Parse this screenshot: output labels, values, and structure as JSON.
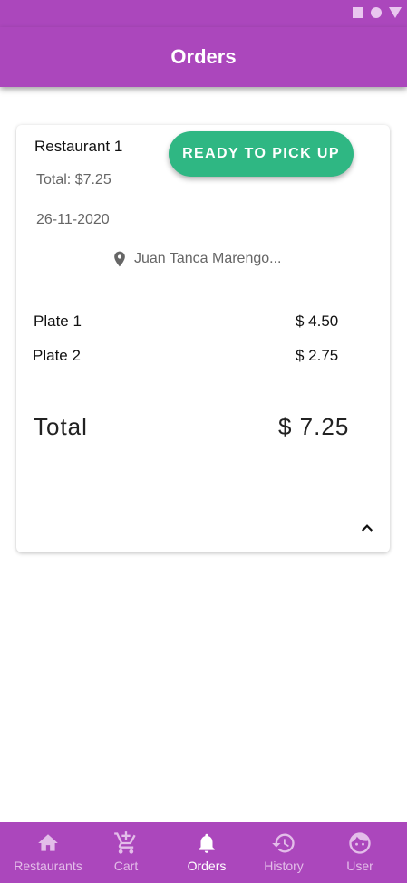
{
  "app": {
    "title": "Orders"
  },
  "order": {
    "restaurant": "Restaurant 1",
    "total_summary": "Total:  $7.25",
    "date": "26-11-2020",
    "status_button": "READY TO PICK UP",
    "location": "Juan Tanca Marengo...",
    "items": [
      {
        "name": "Plate 1",
        "price": "$ 4.50"
      },
      {
        "name": "Plate 2",
        "price": "$ 2.75"
      }
    ],
    "total_label": "Total",
    "total_value": "$ 7.25"
  },
  "nav": {
    "items": [
      {
        "label": "Restaurants",
        "icon": "home-icon"
      },
      {
        "label": "Cart",
        "icon": "cart-icon"
      },
      {
        "label": "Orders",
        "icon": "bell-icon"
      },
      {
        "label": "History",
        "icon": "history-icon"
      },
      {
        "label": "User",
        "icon": "face-icon"
      }
    ],
    "active": "Orders"
  },
  "colors": {
    "primary": "#ab47bc",
    "accent_button": "#2fb783",
    "nav_inactive": "#e3bde9",
    "nav_active": "#ffffff"
  }
}
